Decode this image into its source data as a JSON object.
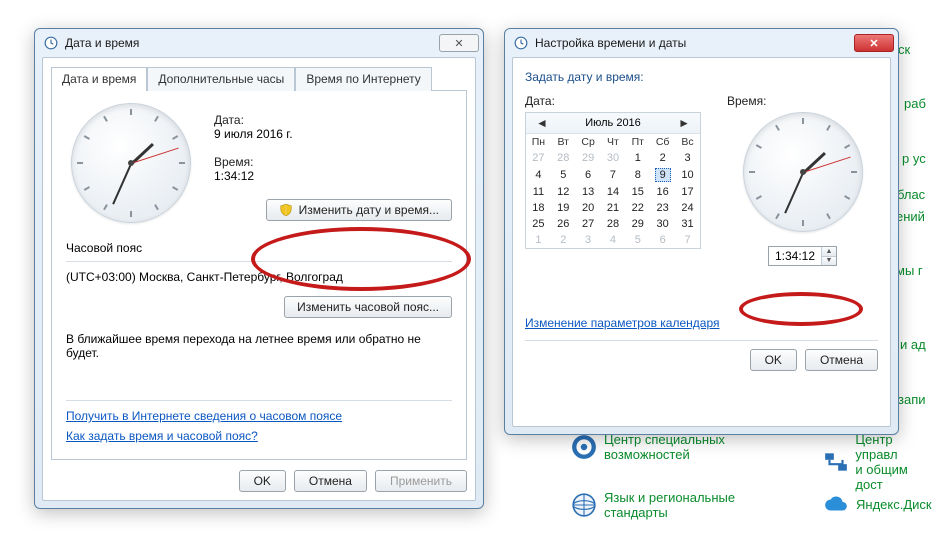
{
  "window1": {
    "title": "Дата и время",
    "tabs": [
      "Дата и время",
      "Дополнительные часы",
      "Время по Интернету"
    ],
    "date_label": "Дата:",
    "date_value": "9 июля 2016 г.",
    "time_label": "Время:",
    "time_value": "1:34:12",
    "change_dt_btn": "Изменить дату и время...",
    "tz_header": "Часовой пояс",
    "tz_value": "(UTC+03:00) Москва, Санкт-Петербург, Волгоград",
    "change_tz_btn": "Изменить часовой пояс...",
    "dst_note": "В ближайшее время перехода на летнее время или обратно не будет.",
    "link_tz_online": "Получить в Интернете сведения о часовом поясе",
    "link_howto": "Как задать время и часовой пояс?",
    "ok": "OK",
    "cancel": "Отмена",
    "apply": "Применить"
  },
  "window2": {
    "title": "Настройка времени и даты",
    "instruction": "Задать дату и время:",
    "date_label": "Дата:",
    "time_label": "Время:",
    "month_title": "Июль 2016",
    "dow": [
      "Пн",
      "Вт",
      "Ср",
      "Чт",
      "Пт",
      "Сб",
      "Вс"
    ],
    "weeks": [
      [
        {
          "d": 27,
          "m": 1
        },
        {
          "d": 28,
          "m": 1
        },
        {
          "d": 29,
          "m": 1
        },
        {
          "d": 30,
          "m": 1
        },
        {
          "d": 1
        },
        {
          "d": 2
        },
        {
          "d": 3
        }
      ],
      [
        {
          "d": 4
        },
        {
          "d": 5
        },
        {
          "d": 6
        },
        {
          "d": 7
        },
        {
          "d": 8
        },
        {
          "d": 9,
          "sel": 1
        },
        {
          "d": 10
        }
      ],
      [
        {
          "d": 11
        },
        {
          "d": 12
        },
        {
          "d": 13
        },
        {
          "d": 14
        },
        {
          "d": 15
        },
        {
          "d": 16
        },
        {
          "d": 17
        }
      ],
      [
        {
          "d": 18
        },
        {
          "d": 19
        },
        {
          "d": 20
        },
        {
          "d": 21
        },
        {
          "d": 22
        },
        {
          "d": 23
        },
        {
          "d": 24
        }
      ],
      [
        {
          "d": 25
        },
        {
          "d": 26
        },
        {
          "d": 27
        },
        {
          "d": 28
        },
        {
          "d": 29
        },
        {
          "d": 30
        },
        {
          "d": 31
        }
      ],
      [
        {
          "d": 1,
          "m": 1
        },
        {
          "d": 2,
          "m": 1
        },
        {
          "d": 3,
          "m": 1
        },
        {
          "d": 4,
          "m": 1
        },
        {
          "d": 5,
          "m": 1
        },
        {
          "d": 6,
          "m": 1
        },
        {
          "d": 7,
          "m": 1
        }
      ]
    ],
    "time_value": "1:34:12",
    "cal_settings_link": "Изменение параметров календаря",
    "ok": "OK",
    "cancel": "Отмена"
  },
  "background": {
    "r1": "ск",
    "r2": "раб",
    "r3": "р ус",
    "r4": "блас",
    "r5": "ений",
    "r6": "мы г",
    "r7": "и ад",
    "r8": "запи",
    "item_accessibility": "Центр специальных\nвозможностей",
    "item_manage": "Центр управл\nи общим дост",
    "item_lang": "Язык и региональные\nстандарты",
    "item_yadisk": "Яндекс.Диск"
  }
}
